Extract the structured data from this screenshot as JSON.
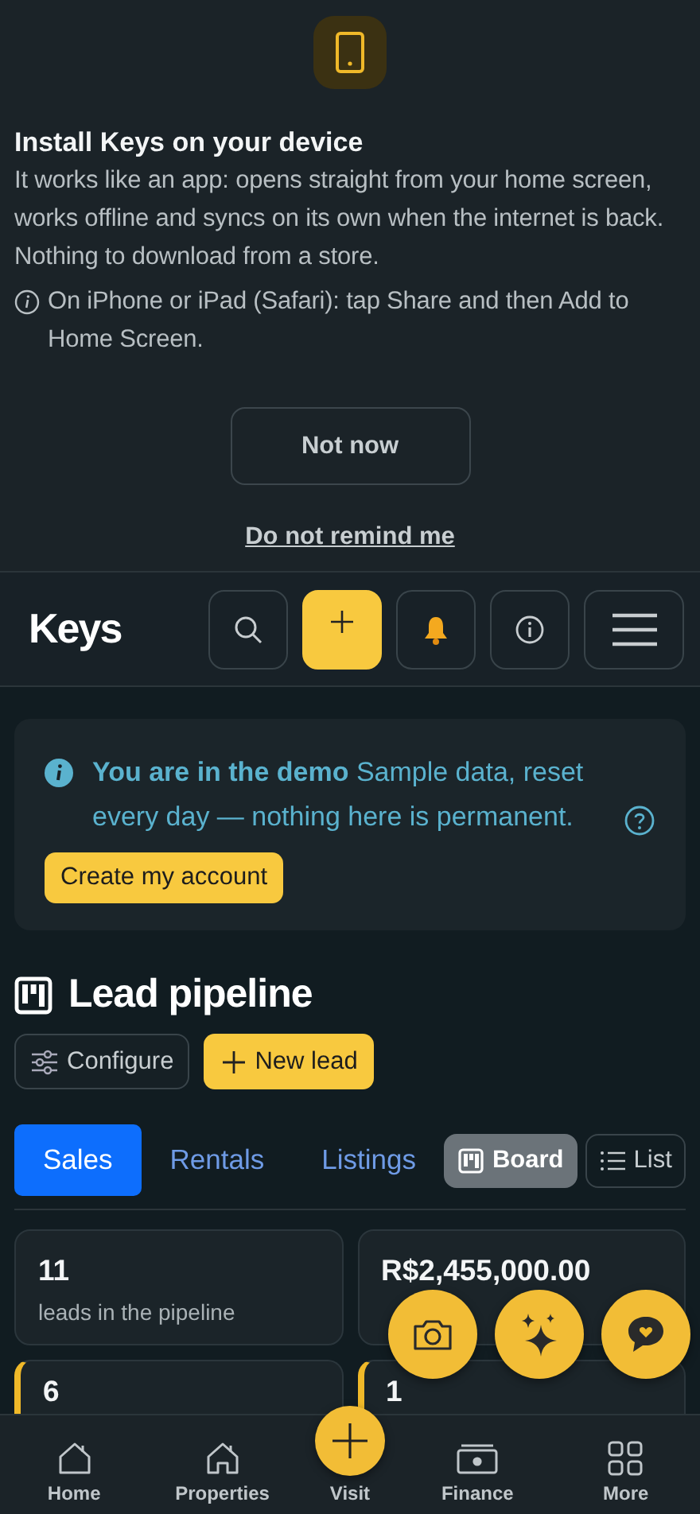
{
  "install_prompt": {
    "title": "Install Keys on your device",
    "body": "It works like an app: opens straight from your home screen, works offline and syncs on its own when the internet is back. Nothing to download from a store.",
    "tip": "On iPhone or iPad (Safari): tap Share and then Add to Home Screen.",
    "dismiss_button": "Not now",
    "never_link": "Do not remind me"
  },
  "header": {
    "logo": "Keys"
  },
  "demo_banner": {
    "text": "**You are in the demo** Sample data, reset every day — nothing here is permanent.",
    "button": "Create my account"
  },
  "pipeline": {
    "title": "Lead pipeline",
    "configure_button": "Configure",
    "new_button": "New lead",
    "tabs": [
      {
        "label": "Sales",
        "selected": true
      },
      {
        "label": "Rentals",
        "selected": false
      },
      {
        "label": "Listings",
        "selected": false
      }
    ],
    "views": [
      {
        "label": "Board",
        "kind": "board",
        "selected": true
      },
      {
        "label": "List",
        "kind": "list",
        "selected": false
      }
    ],
    "stats": [
      {
        "value": "11",
        "label": "leads in the pipeline"
      },
      {
        "value": "R$2,455,000.00"
      }
    ],
    "stage_cards": [
      {
        "value": "6"
      },
      {
        "value": "1"
      }
    ]
  },
  "bottom_nav": [
    {
      "label": "Home",
      "kind": "home"
    },
    {
      "label": "Properties",
      "kind": "house"
    },
    {
      "label": "Visit",
      "kind": "add"
    },
    {
      "label": "Finance",
      "kind": "money"
    },
    {
      "label": "More",
      "kind": "grid"
    }
  ]
}
